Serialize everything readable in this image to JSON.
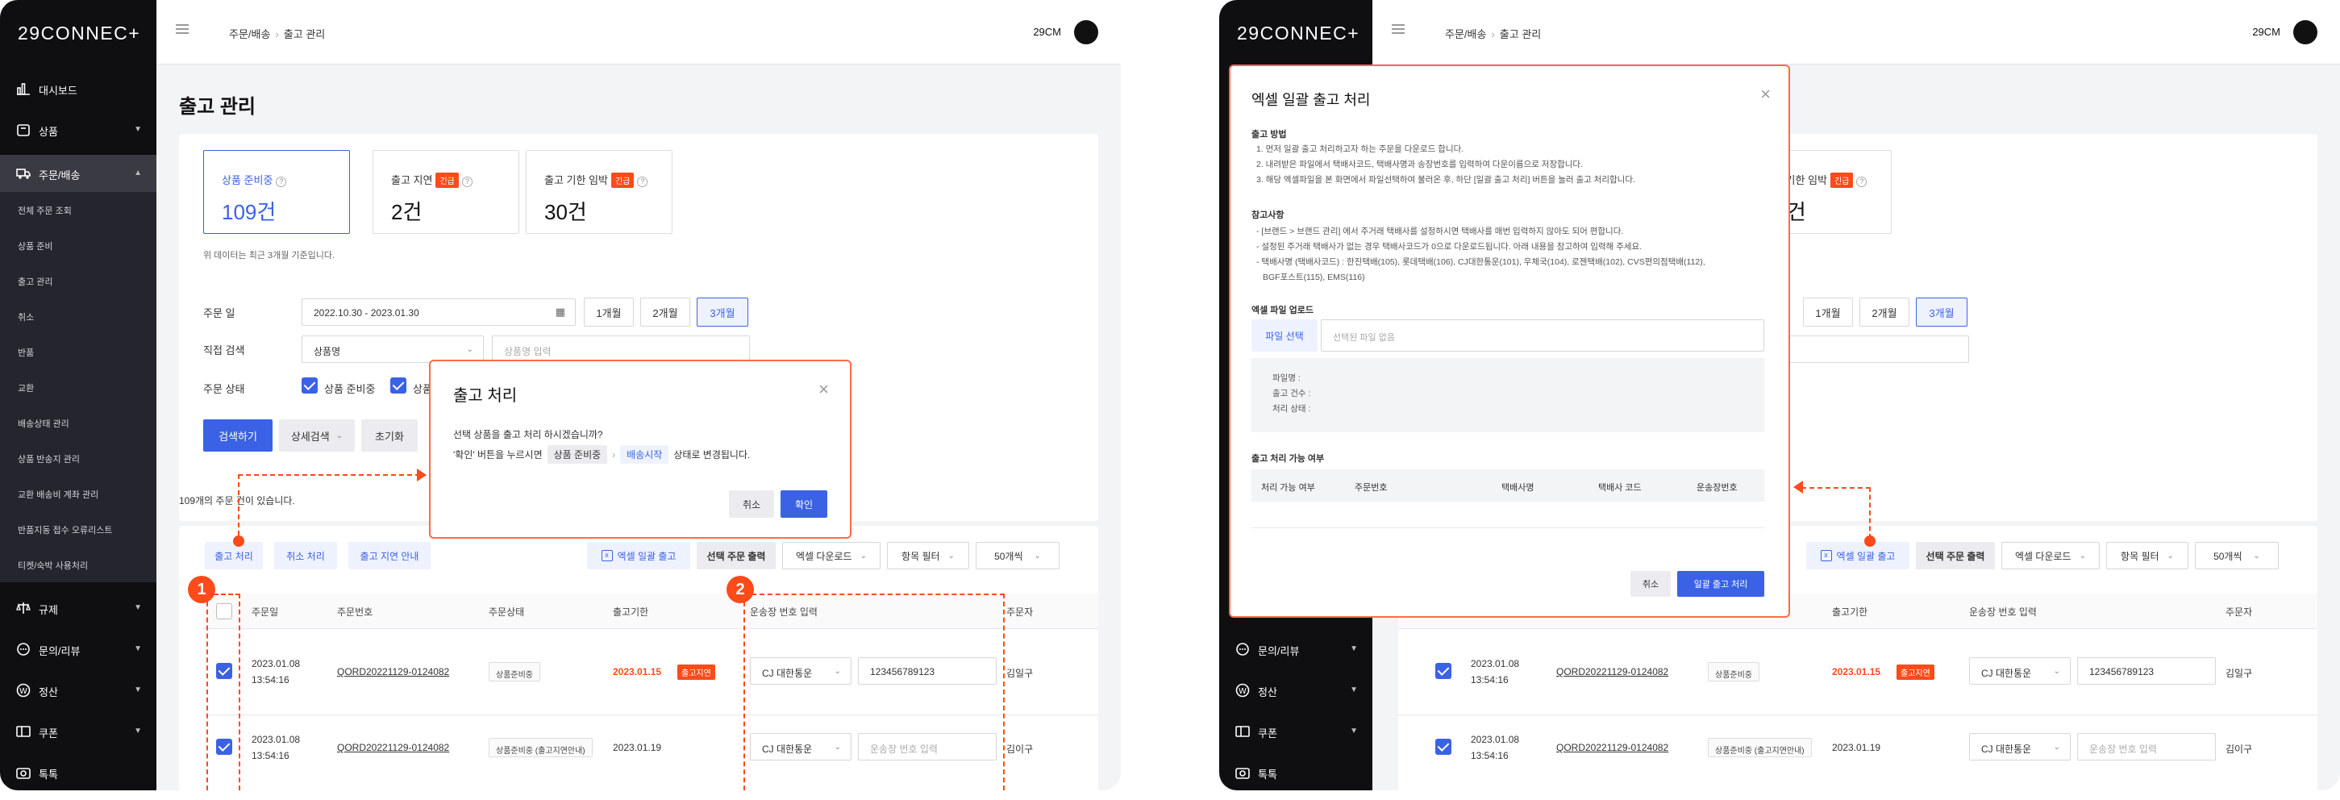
{
  "app": {
    "logo": "29CONNEC+",
    "breadcrumb": [
      "주문/배송",
      "출고 관리"
    ],
    "user": "29CM",
    "page_title": "출고 관리"
  },
  "sidebar": {
    "items": [
      {
        "label": "대시보드",
        "icon": "dashboard-icon"
      },
      {
        "label": "상품",
        "icon": "product-icon"
      },
      {
        "label": "주문/배송",
        "icon": "truck-icon"
      },
      {
        "label": "규제",
        "icon": "scale-icon"
      },
      {
        "label": "문의/리뷰",
        "icon": "chat-icon"
      },
      {
        "label": "정산",
        "icon": "won-icon"
      },
      {
        "label": "쿠폰",
        "icon": "coupon-icon"
      },
      {
        "label": "톡톡",
        "icon": "camera-icon"
      }
    ],
    "subitems": [
      "전체 주문 조회",
      "상품 준비",
      "출고 관리",
      "취소",
      "반품",
      "교환",
      "배송상태 관리",
      "상품 반송지 관리",
      "교환 배송비 계좌 관리",
      "반품지동 접수 오류리스트",
      "티켓/숙박 사용처리"
    ]
  },
  "status_cards": [
    {
      "label": "상품 준비중",
      "value": "109건",
      "urgent": ""
    },
    {
      "label": "출고 지연",
      "value": "2건",
      "urgent": "긴급"
    },
    {
      "label": "출고 기한 임박",
      "value": "30건",
      "urgent": "긴급"
    }
  ],
  "status_note": "위 데이터는 최근 3개월 기준입니다.",
  "filters": {
    "order_date_label": "주문 일",
    "date_range": "2022.10.30 - 2023.01.30",
    "periods": [
      "1개월",
      "2개월",
      "3개월"
    ],
    "direct_search_label": "직접 검색",
    "search_type": "상품명",
    "search_placeholder": "상품명 입력",
    "order_status_label": "주문 상태",
    "status_options": [
      "상품 준비중",
      "상품"
    ],
    "search_button": "검색하기",
    "detail_button": "상세검색",
    "reset_button": "초기화"
  },
  "result_text": "109개의 주문 건이 있습니다.",
  "actions": {
    "ship": "출고 처리",
    "cancel_ship": "취소 처리",
    "delay_notice": "출고 지연 안내",
    "excel_ship": "엑셀 일괄 출고",
    "print": "선택 주문 출력",
    "excel_download": "엑셀 다운로드",
    "field_filter": "항목 필터",
    "per_page": "50개씩"
  },
  "table": {
    "headers": [
      "주문일",
      "주문번호",
      "주문상태",
      "출고기한",
      "운송장 번호 입력",
      "주문자"
    ],
    "rows": [
      {
        "date": "2023.01.08",
        "time": "13:54:16",
        "order_no": "QORD20221129-0124082",
        "status": "상품준비중",
        "deadline": "2023.01.15",
        "delay": "출고지연",
        "courier": "CJ 대한통운",
        "tracking": "123456789123",
        "tracking_placeholder": "",
        "buyer": "김일구"
      },
      {
        "date": "2023.01.08",
        "time": "13:54:16",
        "order_no": "QORD20221129-0124082",
        "status": "상품준비중 (출고지연안내)",
        "deadline": "2023.01.19",
        "delay": "",
        "courier": "CJ 대한통운",
        "tracking": "",
        "tracking_placeholder": "운송장 번호 입력",
        "buyer": "김이구"
      }
    ]
  },
  "ship_modal": {
    "title": "출고 처리",
    "question": "선택 상품을 출고 처리 하시겠습니까?",
    "desc_prefix": "'확인' 버튼을 누르시면",
    "from_status": "상품 준비중",
    "arrow": "›",
    "to_status": "배송시작",
    "desc_suffix": "상태로 변경됩니다.",
    "cancel": "취소",
    "confirm": "확인"
  },
  "excel_modal": {
    "title": "엑셀 일괄 출고 처리",
    "method_title": "출고 방법",
    "method_lines": [
      "1. 먼저 일괄 출고 처리하고자 하는 주문을 다운로드 합니다.",
      "2. 내려받은 파일에서 택배사코드, 택배사명과 송장번호를 입력하여 다운이름으로 저장합니다.",
      "3. 해당 엑셀파일을 본 화면에서 파일선택하여 불러온 후, 하단 [일괄 출고 처리] 버튼을 눌러 출고 처리합니다."
    ],
    "ref_title": "참고사항",
    "ref_lines": [
      "- [브랜드 > 브랜드 관리] 에서 주거래 택배사를 설정하시면 택배사를 매번 입력하지 않아도 되어 편합니다.",
      "- 설정된 주거래 택배사가 없는 경우 택배사코드가 0으로 다운로드됩니다. 아래 내용을 참고하여 입력해 주세요.",
      "- 택배사명 (택배사코드) : 한진택배(105), 롯데택배(106), CJ대한통운(101), 우체국(104), 로젠택배(102), CVS편의점택배(112),",
      "  BGF포스트(115), EMS(116)"
    ],
    "upload_title": "엑셀 파일 업로드",
    "file_button": "파일 선택",
    "file_placeholder": "선택된 파일 없음",
    "info_lines": [
      "파일명 :",
      "출고 건수 :",
      "처리 상태 :"
    ],
    "possible_title": "출고 처리 가능 여부",
    "cols": [
      "처리 가능 여부",
      "주문번호",
      "택배사명",
      "택배사 코드",
      "운송장번호"
    ],
    "cancel": "취소",
    "submit": "일괄 출고 처리"
  },
  "annotations": [
    "1",
    "2"
  ],
  "colors": {
    "accent": "#3b62e4",
    "highlight": "#ff4a1a",
    "sidebar": "#0f0f12"
  }
}
